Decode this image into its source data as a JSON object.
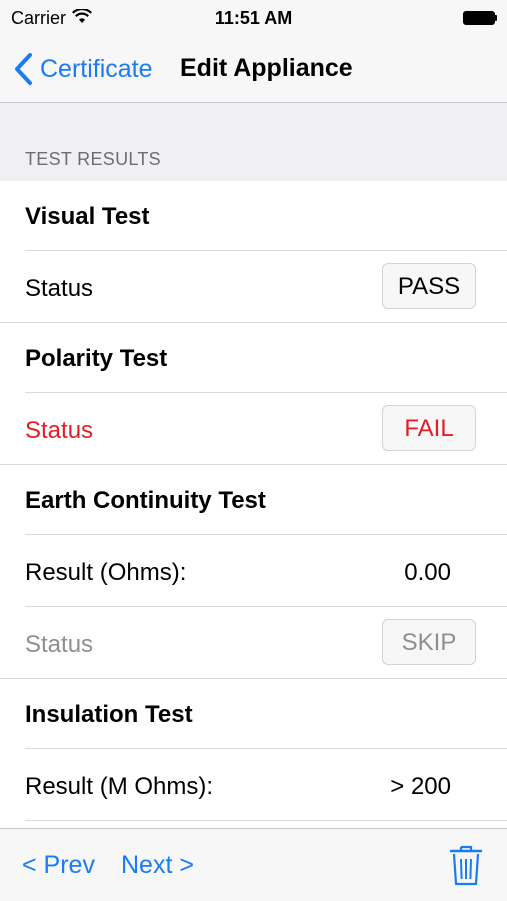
{
  "status_bar": {
    "carrier": "Carrier",
    "time": "11:51 AM"
  },
  "nav": {
    "back_label": "Certificate",
    "title": "Edit Appliance"
  },
  "section": {
    "header": "TEST RESULTS"
  },
  "tests": {
    "visual": {
      "title": "Visual Test",
      "status_label": "Status",
      "status_value": "PASS"
    },
    "polarity": {
      "title": "Polarity Test",
      "status_label": "Status",
      "status_value": "FAIL"
    },
    "earth": {
      "title": "Earth Continuity Test",
      "result_label": "Result (Ohms):",
      "result_value": "0.00",
      "status_label": "Status",
      "status_value": "SKIP"
    },
    "insulation": {
      "title": "Insulation Test",
      "result_label": "Result (M Ohms):",
      "result_value": "> 200"
    }
  },
  "toolbar": {
    "prev_label": "<  Prev",
    "next_label": "Next  >"
  },
  "colors": {
    "tint": "#1a7cf5",
    "fail": "#e31d25",
    "skip": "#8e8e93"
  },
  "icons": [
    "wifi-icon",
    "battery-icon",
    "back-chevron-icon",
    "trash-icon"
  ]
}
